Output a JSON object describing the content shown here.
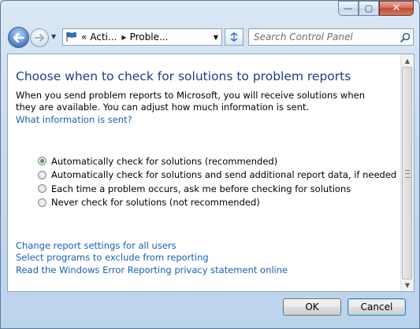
{
  "window": {
    "caption_buttons": {
      "minimize": "—",
      "maximize": "▢",
      "close": "✕"
    }
  },
  "navbar": {
    "breadcrumb_prefix": "«",
    "breadcrumb": [
      "Acti...",
      "Proble..."
    ],
    "breadcrumb_sep": "▶",
    "dropdown": "▼",
    "search_placeholder": "Search Control Panel"
  },
  "main": {
    "title": "Choose when to check for solutions to problem reports",
    "description": "When you send problem reports to Microsoft, you will receive solutions when they are available. You can adjust how much information is sent.",
    "info_link": "What information is sent?",
    "options": [
      {
        "label": "Automatically check for solutions (recommended)",
        "checked": true
      },
      {
        "label": "Automatically check for solutions and send additional report data, if needed",
        "checked": false
      },
      {
        "label": "Each time a problem occurs, ask me before checking for solutions",
        "checked": false
      },
      {
        "label": "Never check for solutions (not recommended)",
        "checked": false
      }
    ],
    "links": [
      "Change report settings for all users",
      "Select programs to exclude from reporting",
      "Read the Windows Error Reporting privacy statement online"
    ]
  },
  "footer": {
    "ok_label": "OK",
    "cancel_label": "Cancel"
  },
  "colors": {
    "title": "#1e3d87",
    "link": "#1a5fb4",
    "close_button": "#c04a33"
  }
}
